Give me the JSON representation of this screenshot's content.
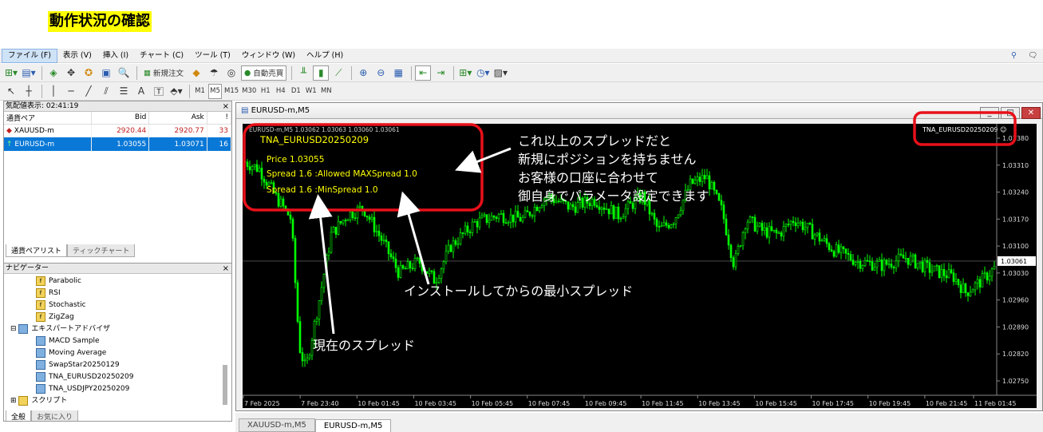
{
  "page_title": "動作状況の確認",
  "menu": [
    "ファイル (F)",
    "表示 (V)",
    "挿入 (I)",
    "チャート (C)",
    "ツール (T)",
    "ウィンドウ (W)",
    "ヘルプ (H)"
  ],
  "toolbar": {
    "new_order": "新規注文",
    "auto_trade": "自動売買"
  },
  "timeframes": [
    "M1",
    "M5",
    "M15",
    "M30",
    "H1",
    "H4",
    "D1",
    "W1",
    "MN"
  ],
  "market_watch": {
    "title": "気配値表示: 02:41:19",
    "cols": [
      "通貨ペア",
      "Bid",
      "Ask",
      "!"
    ],
    "rows": [
      [
        "XAUUSD-m",
        "2920.44",
        "2920.77",
        "33"
      ],
      [
        "EURUSD-m",
        "1.03055",
        "1.03071",
        "16"
      ]
    ],
    "tabs": [
      "通貨ペアリスト",
      "ティックチャート"
    ]
  },
  "navigator": {
    "title": "ナビゲーター",
    "items": [
      "Parabolic",
      "RSI",
      "Stochastic",
      "ZigZag",
      "エキスパートアドバイザ",
      "MACD Sample",
      "Moving Average",
      "SwapStar20250129",
      "TNA_EURUSD20250209",
      "TNA_USDJPY20250209",
      "スクリプト"
    ],
    "tabs": [
      "全般",
      "お気に入り"
    ]
  },
  "chart_window": {
    "title": "EURUSD-m,M5",
    "ohlc": "EURUSD-m,M5  1.03062 1.03063 1.03060 1.03061",
    "ea_label": "TNA_EURUSD20250209 ☺",
    "info": [
      "TNA_EURUSD20250209",
      "Price  1.03055",
      "Spread  1.6  :Allowed MAXSpread  1.0",
      "Spread  1.6  :MinSpread  1.0"
    ],
    "price_ticks": [
      "1.03380",
      "1.03310",
      "1.03240",
      "1.03170",
      "1.03100",
      "1.03030",
      "1.02960",
      "1.02890",
      "1.02820",
      "1.02750"
    ],
    "current_price": "1.03061",
    "time_ticks": [
      "7 Feb 2025",
      "7 Feb 23:40",
      "10 Feb 01:45",
      "10 Feb 03:45",
      "10 Feb 05:45",
      "10 Feb 07:45",
      "10 Feb 09:45",
      "10 Feb 11:45",
      "10 Feb 13:45",
      "10 Feb 15:45",
      "10 Feb 17:45",
      "10 Feb 19:45",
      "10 Feb 21:45",
      "11 Feb 01:45"
    ]
  },
  "annotations": {
    "a1": [
      "これ以上のスプレッドだと",
      "新規にポジションを持ちません",
      "お客様の口座に合わせて",
      "御自身でパラメータ設定できます"
    ],
    "a2": "インストールしてからの最小スプレッド",
    "a3": "現在のスプレッド"
  },
  "bottom_tabs": [
    "XAUUSD-m,M5",
    "EURUSD-m,M5"
  ],
  "colors": {
    "candle": "#00ff00",
    "info_text": "#ffff00",
    "highlight_box": "#e8101a",
    "selected_row": "#0a78d7"
  }
}
